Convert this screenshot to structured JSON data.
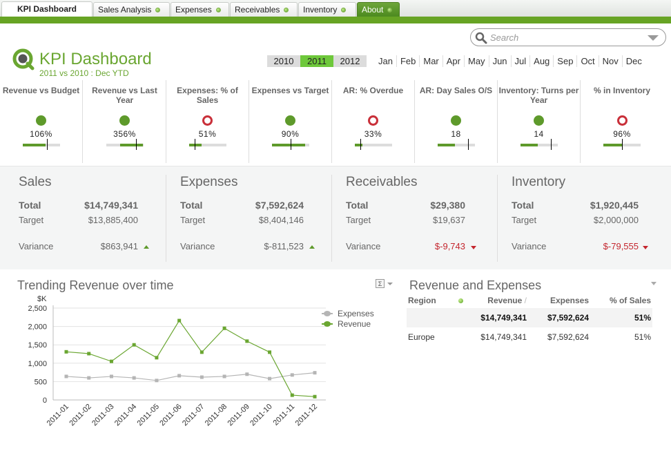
{
  "tabs": [
    {
      "label": "KPI Dashboard",
      "active": true
    },
    {
      "label": "Sales Analysis"
    },
    {
      "label": "Expenses"
    },
    {
      "label": "Receivables"
    },
    {
      "label": "Inventory"
    },
    {
      "label": "About"
    }
  ],
  "header": {
    "title": "KPI Dashboard",
    "subtitle": "2011 vs 2010 : Dec YTD",
    "search_placeholder": "Search"
  },
  "years": [
    {
      "label": "2010",
      "selected": false
    },
    {
      "label": "2011",
      "selected": true
    },
    {
      "label": "2012",
      "selected": false
    }
  ],
  "months": [
    "Jan",
    "Feb",
    "Mar",
    "Apr",
    "May",
    "Jun",
    "Jul",
    "Aug",
    "Sep",
    "Oct",
    "Nov",
    "Dec"
  ],
  "kpis": [
    {
      "label": "Revenue vs Budget",
      "value": "106%",
      "status": "good",
      "fill_start": 0,
      "fill_end": 0.62,
      "marker": 0.65
    },
    {
      "label": "Revenue vs Last Year",
      "value": "356%",
      "status": "good",
      "fill_start": 0.38,
      "fill_end": 1.0,
      "marker": 0.8
    },
    {
      "label": "Expenses: % of Sales",
      "value": "51%",
      "status": "bad",
      "fill_start": 0,
      "fill_end": 0.35,
      "marker": 0.15
    },
    {
      "label": "Expenses vs Target",
      "value": "90%",
      "status": "good",
      "fill_start": 0,
      "fill_end": 0.9,
      "marker": 0.5
    },
    {
      "label": "AR: % Overdue",
      "value": "33%",
      "status": "bad",
      "fill_start": 0,
      "fill_end": 0.22,
      "marker": 0.15
    },
    {
      "label": "AR: Day Sales O/S",
      "value": "18",
      "status": "good",
      "fill_start": 0,
      "fill_end": 0.47,
      "marker": 0.83
    },
    {
      "label": "Inventory: Turns per Year",
      "value": "14",
      "status": "good",
      "fill_start": 0,
      "fill_end": 0.47,
      "marker": 0.83
    },
    {
      "label": "% in Inventory",
      "value": "96%",
      "status": "bad",
      "fill_start": 0,
      "fill_end": 0.5,
      "marker": 0.5
    }
  ],
  "summary": [
    {
      "title": "Sales",
      "total_label": "Total",
      "total": "$14,749,341",
      "target_label": "Target",
      "target": "$13,885,400",
      "variance_label": "Variance",
      "variance": "$863,941",
      "trend": "up"
    },
    {
      "title": "Expenses",
      "total_label": "Total",
      "total": "$7,592,624",
      "target_label": "Target",
      "target": "$8,404,146",
      "variance_label": "Variance",
      "variance": "$-811,523",
      "trend": "up"
    },
    {
      "title": "Receivables",
      "total_label": "Total",
      "total": "$29,380",
      "target_label": "Target",
      "target": "$19,637",
      "variance_label": "Variance",
      "variance": "$-9,743",
      "trend": "down"
    },
    {
      "title": "Inventory",
      "total_label": "Total",
      "total": "$1,920,445",
      "target_label": "Target",
      "target": "$2,000,000",
      "variance_label": "Variance",
      "variance": "$-79,555",
      "trend": "down"
    }
  ],
  "colors": {
    "accent": "#67a424",
    "good": "#5e9a2b",
    "bad": "#c9303a",
    "expenses_line": "#b5b5b5",
    "revenue_line": "#6aa631"
  },
  "chart_data": {
    "type": "line",
    "title": "Trending Revenue over time",
    "ylabel": "$K",
    "xlabel": "",
    "ylim": [
      0,
      2500
    ],
    "yticks": [
      0,
      500,
      1000,
      1500,
      2000,
      2500
    ],
    "ytick_labels": [
      "0",
      "500",
      "1,000",
      "1,500",
      "2,000",
      "2,500"
    ],
    "grid": true,
    "legend": "top-right",
    "categories": [
      "2011-01",
      "2011-02",
      "2011-03",
      "2011-04",
      "2011-05",
      "2011-06",
      "2011-07",
      "2011-08",
      "2011-09",
      "2011-10",
      "2011-11",
      "2011-12"
    ],
    "series": [
      {
        "name": "Expenses",
        "values": [
          640,
          600,
          640,
          600,
          530,
          660,
          620,
          640,
          700,
          580,
          680,
          740
        ]
      },
      {
        "name": "Revenue",
        "values": [
          1310,
          1260,
          1050,
          1500,
          1150,
          2160,
          1300,
          1950,
          1600,
          1300,
          130,
          90
        ]
      }
    ]
  },
  "revenue_table": {
    "title": "Revenue and Expenses",
    "headers": [
      "Region",
      "Revenue",
      "Expenses",
      "% of Sales"
    ],
    "sort_indicator": "/",
    "total_row": [
      "",
      "$14,749,341",
      "$7,592,624",
      "51%"
    ],
    "rows": [
      [
        "Europe",
        "$14,749,341",
        "$7,592,624",
        "51%"
      ]
    ]
  }
}
